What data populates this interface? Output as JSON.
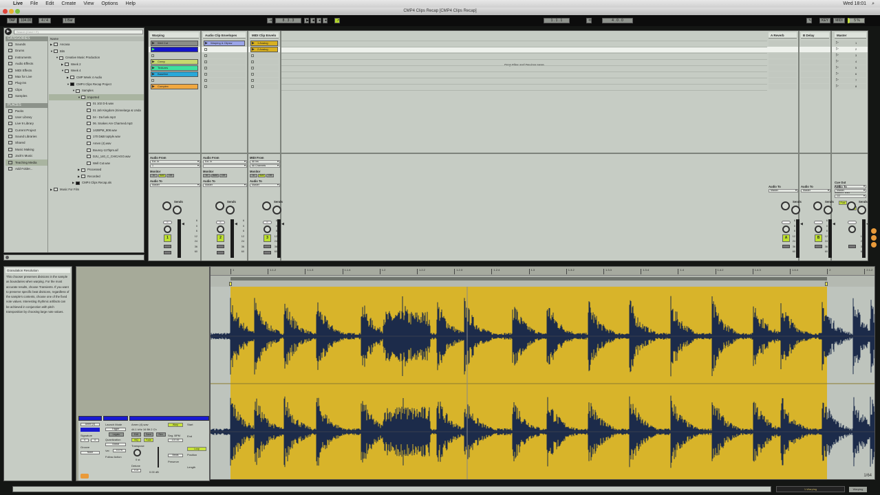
{
  "menubar": {
    "app": "Live",
    "items": [
      "File",
      "Edit",
      "Create",
      "View",
      "Options",
      "Help"
    ],
    "clock": "Wed 18:01"
  },
  "window": {
    "title": "CMP4 Clips Recap  [CMP4 Clips Recap]"
  },
  "control_bar": {
    "tap": "TAP",
    "tempo": "104.00",
    "sig": "4 / 4",
    "metro": "1 Bar",
    "position": "8 . 3 . 3",
    "loop_start": "1 . 1 . 1",
    "loop_len": "4 . 0 . 0",
    "key": "KEY",
    "midi": "MIDI",
    "cpu": "5 %"
  },
  "browser": {
    "search_placeholder": "Search (Cmd + F)",
    "categories_header": "CATEGORIES",
    "categories": [
      "Sounds",
      "Drums",
      "Instruments",
      "Audio Effects",
      "MIDI Effects",
      "Max for Live",
      "Plug-ins",
      "Clips",
      "Samples"
    ],
    "places_header": "PLACES",
    "places": [
      "Packs",
      "User Library",
      "Live 9 Library",
      "Current Project",
      "Sound Libraries",
      "Shared",
      "Music Making",
      "Jack's Music",
      "Teaching Media",
      "Add Folder..."
    ],
    "tree_header": "Name",
    "tree": [
      {
        "label": "Ancasa",
        "depth": 0,
        "arrow": "▶",
        "type": "folder"
      },
      {
        "label": "Bits",
        "depth": 0,
        "arrow": "▼",
        "type": "folder"
      },
      {
        "label": "Creative Music Production",
        "depth": 1,
        "arrow": "▼",
        "type": "folder"
      },
      {
        "label": "Week 2",
        "depth": 2,
        "arrow": "▶",
        "type": "folder"
      },
      {
        "label": "Week 4",
        "depth": 2,
        "arrow": "▼",
        "type": "folder"
      },
      {
        "label": "CMP Week 4 Audio",
        "depth": 3,
        "arrow": "▶",
        "type": "folder"
      },
      {
        "label": "CMP4 Clips Recap Project",
        "depth": 3,
        "arrow": "▼",
        "type": "project"
      },
      {
        "label": "Samples",
        "depth": 4,
        "arrow": "▼",
        "type": "folder"
      },
      {
        "label": "Imported",
        "depth": 5,
        "arrow": "▼",
        "type": "folder",
        "selected": true
      },
      {
        "label": "01 102 D-b.wav",
        "depth": 6,
        "arrow": "",
        "type": "file"
      },
      {
        "label": "01 Jah Kingdom (Kinnelargo & Unda",
        "depth": 6,
        "arrow": "",
        "type": "file"
      },
      {
        "label": "04 - Da funk.mp3",
        "depth": 6,
        "arrow": "",
        "type": "file"
      },
      {
        "label": "06. Snakes Are Charmed.mp3",
        "depth": 6,
        "arrow": "",
        "type": "file"
      },
      {
        "label": "142BPM_808.wav",
        "depth": 6,
        "arrow": "",
        "type": "file"
      },
      {
        "label": "170 D&B toptyle.wav",
        "depth": 6,
        "arrow": "",
        "type": "file"
      },
      {
        "label": "Amen (4).wav",
        "depth": 6,
        "arrow": "",
        "type": "file"
      },
      {
        "label": "Bouncy-117bpm.aif",
        "depth": 6,
        "arrow": "",
        "type": "file"
      },
      {
        "label": "DJU_140_C_CHICAGO.wav",
        "depth": 6,
        "arrow": "",
        "type": "file"
      },
      {
        "label": "Well Cut.wav",
        "depth": 6,
        "arrow": "",
        "type": "file"
      },
      {
        "label": "Processed",
        "depth": 5,
        "arrow": "▶",
        "type": "folder"
      },
      {
        "label": "Recorded",
        "depth": 5,
        "arrow": "▶",
        "type": "folder"
      },
      {
        "label": "CMP4 Clips Recap.als",
        "depth": 4,
        "arrow": "▶",
        "type": "project"
      },
      {
        "label": "Music For Film",
        "depth": 0,
        "arrow": "▶",
        "type": "folder"
      }
    ]
  },
  "session": {
    "drop_hint": "Drop Files and Devices Here",
    "tracks": [
      {
        "name": "Warping",
        "clips": [
          {
            "label": "Well Cut",
            "color": "#8a8d88"
          },
          {
            "label": "",
            "color": "#1414c8",
            "playing": true
          },
          null,
          {
            "label": "Creep",
            "color": "#c8d870"
          },
          {
            "label": "Textures",
            "color": "#40e0a0"
          },
          {
            "label": "Baseline",
            "color": "#2aa8d8"
          },
          null,
          {
            "label": "Complex",
            "color": "#f0a840"
          }
        ],
        "input_label": "Audio From",
        "input": "Ext. In",
        "channel": "1",
        "number": "1",
        "pan": "C"
      },
      {
        "name": "Audio Clip Envelopes",
        "clips": [
          {
            "label": "Warping & Clipsw",
            "color": "#9aa4e8"
          }
        ],
        "input_label": "Audio From",
        "input": "Ext. In",
        "channel": "",
        "number": "2",
        "pan": "C"
      },
      {
        "name": "MIDI Clip Envelo",
        "clips": [
          {
            "label": "1 Analog",
            "color": "#d8b020"
          },
          {
            "label": "2 Analog",
            "color": "#d8b020"
          }
        ],
        "input_label": "MIDI From",
        "input": "All Ins",
        "channel": "All Channels",
        "number": "3",
        "pan": "C"
      }
    ],
    "returns": [
      {
        "name": "A Reverb",
        "letter": "A"
      },
      {
        "name": "B Delay",
        "letter": "B"
      }
    ],
    "master": {
      "name": "Master",
      "scenes": [
        "1",
        "2",
        "3",
        "4",
        "5",
        "6",
        "7",
        "8"
      ],
      "cue_out_label": "Cue Out",
      "cue_out": "1/2",
      "master_out_label": "Master Out",
      "master_out": "1/2"
    },
    "monitor_label": "Monitor",
    "monitor": [
      "In",
      "Auto",
      "Off"
    ],
    "audio_to_label": "Audio To",
    "audio_to": "Master",
    "sends_label": "Sends",
    "post": "Post",
    "db_scale": [
      "6",
      "0",
      "6",
      "12",
      "24",
      "36",
      "60"
    ]
  },
  "info": {
    "title": "Granulation Resolution",
    "body": "This chooser preserves divisions in the sample as boundaries when warping. For the most accurate results, choose Transients. If you want to preserve specific beat divisions, regardless of the sample's contents, choose one of the fixed note values. Interesting rhythmic artifacts can be achieved in conjunction with pitch transposition by choosing large note values."
  },
  "clip_detail": {
    "clip_name": "Amen (4)",
    "signature_label": "Signature",
    "sig_num": "4",
    "sig_den": "4",
    "groove_label": "Groove",
    "groove": "None",
    "launch_mode_label": "Launch Mode",
    "launch_mode": "Trigger",
    "legato": "Legato",
    "quantization_label": "Quantization",
    "quantization": "Global",
    "vel_label": "Vel",
    "vel": "0.0 %",
    "follow_label": "Follow Action",
    "file": "Amen (4).wav",
    "format": "44.1 kHz 16 Bit 2 Ch",
    "edit": "Edit",
    "save": "Save",
    "rev": "Rev.",
    "hiq": "HiQ",
    "fade": "Fade",
    "transpose_label": "Transpose",
    "transpose": "0 st",
    "detune_label": "Detune",
    "detune": "0 ct",
    "gain": "0.00 dB",
    "warp": "Warp",
    "seg_bpm_label": "Seg. BPM",
    "seg_bpm": "137.00",
    "mode": "Beats",
    "preserve_label": "Preserve",
    "start_label": "Start",
    "end_label": "End",
    "loop": "Loop",
    "position_label": "Position",
    "length_label": "Length"
  },
  "arrange": {
    "ruler": [
      "1",
      "1.1.2",
      "1.1.3",
      "1.1.4",
      "1.2",
      "1.2.2",
      "1.2.3",
      "1.2.4",
      "1.3",
      "1.3.2",
      "1.3.3",
      "1.3.4",
      "1.4",
      "1.4.2",
      "1.4.3",
      "1.4.4",
      "2",
      "2.1.2"
    ],
    "zoom": "1/64",
    "waveform_color": "#1c2b4a",
    "region_color": "#d8b42a"
  },
  "status": {
    "mid": "1-Warping",
    "mode": "Warping"
  }
}
